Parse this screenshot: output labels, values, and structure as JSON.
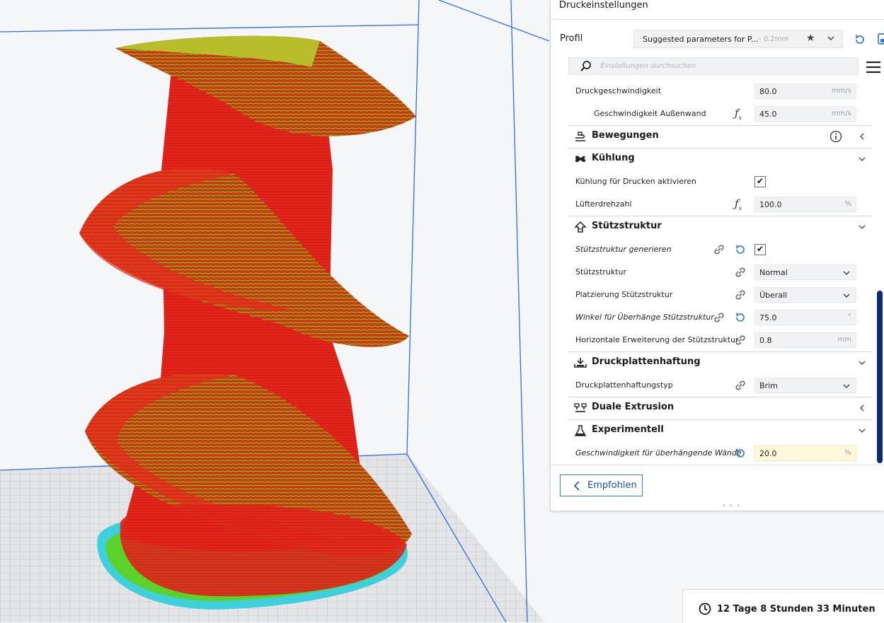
{
  "panel": {
    "title": "Druckeinstellungen",
    "profile_label": "Profil",
    "profile_name": "Suggested parameters for P...",
    "profile_layer": "- 0.2mm",
    "search_placeholder": "Einstellungen durchsuchen",
    "recommended_label": "Empfohlen"
  },
  "settings": {
    "print_speed": {
      "label": "Druckgeschwindigkeit",
      "value": "80.0",
      "unit": "mm/s"
    },
    "outer_wall_speed": {
      "label": "Geschwindigkeit Außenwand",
      "value": "45.0",
      "unit": "mm/s"
    },
    "travel": {
      "label": "Bewegungen"
    },
    "cooling": {
      "label": "Kühlung"
    },
    "enable_cooling": {
      "label": "Kühlung für Drucken aktivieren",
      "checked": true
    },
    "fan_speed": {
      "label": "Lüfterdrehzahl",
      "value": "100.0",
      "unit": "%"
    },
    "support": {
      "label": "Stützstruktur"
    },
    "generate_support": {
      "label": "Stützstruktur generieren",
      "checked": true
    },
    "support_structure": {
      "label": "Stützstruktur",
      "value": "Normal"
    },
    "support_placement": {
      "label": "Platzierung Stützstruktur",
      "value": "Überall"
    },
    "overhang_angle": {
      "label": "Winkel für Überhänge Stützstruktur",
      "value": "75.0",
      "unit": "°"
    },
    "support_expansion": {
      "label": "Horizontale Erweiterung der Stützstruktur",
      "value": "0.8",
      "unit": "mm"
    },
    "adhesion": {
      "label": "Druckplattenhaftung"
    },
    "adhesion_type": {
      "label": "Druckplattenhaftungstyp",
      "value": "Brim"
    },
    "dual_extrusion": {
      "label": "Duale Extrusion"
    },
    "experimental": {
      "label": "Experimentell"
    },
    "overhang_wall_speed": {
      "label": "Geschwindigkeit für überhängende Wände",
      "value": "20.0",
      "unit": "%"
    }
  },
  "print_time": "12 Tage 8 Stunden 33 Minuten",
  "colors": {
    "accent": "#3a7bd5",
    "model": "#e8251c",
    "infill": "#5bd12c",
    "brim": "#3fd0dc",
    "scrollbar": "#0b2c74"
  }
}
